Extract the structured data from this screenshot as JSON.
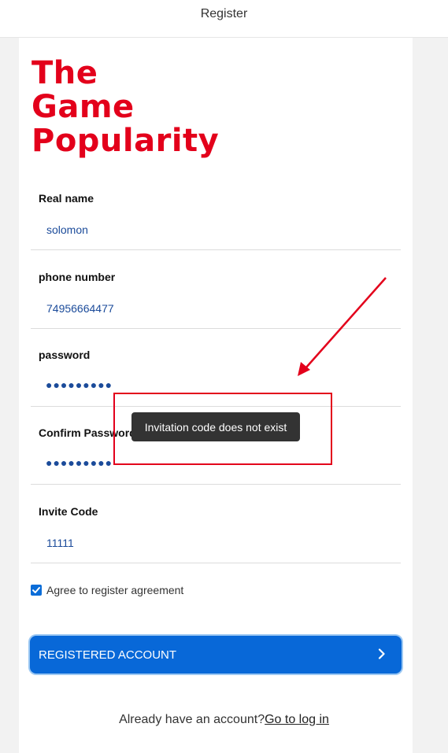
{
  "header": {
    "title": "Register"
  },
  "logo": {
    "line1": "The",
    "line2": "Game",
    "line3": "Popularity"
  },
  "form": {
    "real_name": {
      "label": "Real name",
      "value": "solomon"
    },
    "phone": {
      "label": "phone number",
      "value": "74956664477"
    },
    "password": {
      "label": "password",
      "value": "●●●●●●●●●"
    },
    "confirm_password": {
      "label": "Confirm Password",
      "value": "●●●●●●●●●"
    },
    "invite_code": {
      "label": "Invite Code",
      "value": "11111"
    },
    "agree": {
      "label": "Agree to register agreement",
      "checked": true
    }
  },
  "register_button": {
    "label": "REGISTERED ACCOUNT"
  },
  "login": {
    "prefix": "Already have an account?",
    "link": "Go to log in"
  },
  "toast": {
    "message": "Invitation code does not exist"
  },
  "colors": {
    "brand_red": "#e3001b",
    "primary_blue": "#0868d8",
    "value_blue": "#1b4b9a",
    "toast_bg": "#333333"
  }
}
